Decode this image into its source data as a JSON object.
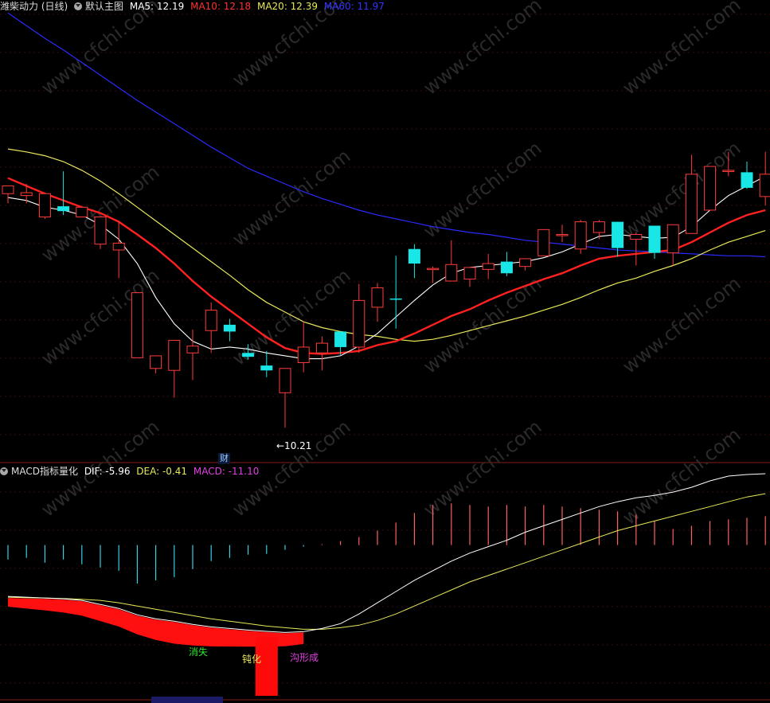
{
  "main_header": {
    "stock_name": "潍柴动力 (日线)",
    "chart_name": "默认主图",
    "ma5": "MA5: 12.19",
    "ma10": "MA10: 12.18",
    "ma20": "MA20: 12.39",
    "ma60": "MA60: 11.97"
  },
  "macd_header": {
    "name": "MACD指标量化",
    "dif": "DIF: -5.96",
    "dea": "DEA: -0.41",
    "macd": "MACD: -11.10"
  },
  "annotations": {
    "low_price": "←10.21",
    "cai_badge": "财",
    "xiaoshi": "消失",
    "dunhua": "钝化",
    "gouxingcheng": "沟形成"
  },
  "colors": {
    "ma5": "#ffffff",
    "ma10": "#ff2020",
    "ma20": "#e8e85a",
    "ma60": "#2a2aff",
    "up": "#ff3b3b",
    "down": "#19e6e6",
    "macd_pos": "#ff6060",
    "macd_neg": "#35d0e8",
    "dif": "#ffffff",
    "dea": "#e8e85a",
    "watermark": "#2a2a2a"
  },
  "chart_data": {
    "type": "candlestick",
    "y_range": [
      9.9,
      14.45
    ],
    "candles": [
      [
        12.62,
        12.7,
        12.52,
        12.7
      ],
      [
        12.6,
        12.63,
        12.72,
        12.52
      ],
      [
        12.38,
        12.62,
        12.62,
        12.36
      ],
      [
        12.49,
        12.44,
        12.85,
        12.4
      ],
      [
        12.38,
        12.48,
        12.48,
        12.38
      ],
      [
        12.1,
        12.38,
        12.38,
        12.05
      ],
      [
        12.04,
        12.11,
        12.34,
        11.75
      ],
      [
        10.93,
        11.6,
        11.6,
        10.93
      ],
      [
        10.82,
        10.95,
        10.95,
        10.77
      ],
      [
        10.8,
        11.11,
        11.11,
        10.52
      ],
      [
        10.98,
        11.05,
        11.22,
        10.7
      ],
      [
        11.21,
        11.42,
        11.5,
        10.98
      ],
      [
        11.27,
        11.2,
        11.33,
        11.1
      ],
      [
        10.98,
        10.94,
        11.07,
        10.91
      ],
      [
        10.85,
        10.8,
        11.0,
        10.73
      ],
      [
        10.57,
        10.82,
        10.82,
        10.21
      ],
      [
        10.88,
        11.04,
        11.3,
        10.78
      ],
      [
        10.98,
        11.08,
        11.15,
        10.8
      ],
      [
        11.2,
        11.04,
        11.2,
        10.96
      ],
      [
        11.04,
        11.52,
        11.69,
        10.98
      ],
      [
        11.45,
        11.65,
        11.7,
        11.3
      ],
      [
        11.54,
        11.53,
        11.98,
        11.23
      ],
      [
        12.05,
        11.9,
        12.1,
        11.75
      ],
      [
        11.85,
        11.85,
        11.87,
        11.7
      ],
      [
        11.72,
        11.89,
        12.14,
        11.72
      ],
      [
        11.74,
        11.86,
        11.86,
        11.66
      ],
      [
        11.84,
        11.9,
        12.0,
        11.74
      ],
      [
        11.92,
        11.8,
        12.02,
        11.77
      ],
      [
        11.87,
        11.95,
        11.95,
        11.83
      ],
      [
        11.98,
        12.25,
        12.25,
        11.98
      ],
      [
        12.2,
        12.2,
        12.3,
        12.12
      ],
      [
        12.05,
        12.33,
        12.35,
        12.0
      ],
      [
        12.22,
        12.33,
        12.35,
        12.15
      ],
      [
        12.33,
        12.06,
        12.33,
        11.97
      ],
      [
        12.15,
        12.2,
        12.22,
        11.88
      ],
      [
        12.29,
        12.01,
        12.29,
        11.95
      ],
      [
        12.01,
        12.3,
        12.3,
        11.88
      ],
      [
        12.21,
        12.82,
        13.02,
        12.21
      ],
      [
        12.45,
        12.9,
        12.9,
        12.45
      ],
      [
        12.86,
        12.86,
        13.05,
        12.8
      ],
      [
        12.84,
        12.68,
        12.95,
        12.67
      ],
      [
        12.59,
        12.82,
        13.05,
        12.5
      ]
    ],
    "ma5": [
      12.58,
      12.55,
      12.48,
      12.45,
      12.4,
      12.3,
      12.15,
      11.9,
      11.55,
      11.28,
      11.1,
      11.02,
      11.04,
      11.02,
      10.98,
      10.95,
      10.92,
      10.92,
      10.95,
      11.05,
      11.18,
      11.35,
      11.52,
      11.68,
      11.8,
      11.86,
      11.88,
      11.9,
      11.92,
      11.96,
      12.02,
      12.1,
      12.18,
      12.2,
      12.18,
      12.16,
      12.17,
      12.28,
      12.45,
      12.6,
      12.7,
      12.8
    ],
    "ma10": [
      12.78,
      12.7,
      12.62,
      12.55,
      12.48,
      12.42,
      12.33,
      12.2,
      12.06,
      11.9,
      11.72,
      11.56,
      11.42,
      11.28,
      11.14,
      11.03,
      10.98,
      10.97,
      10.98,
      11.0,
      11.06,
      11.1,
      11.18,
      11.27,
      11.36,
      11.43,
      11.52,
      11.6,
      11.67,
      11.74,
      11.8,
      11.88,
      11.95,
      11.98,
      12.0,
      12.02,
      12.04,
      12.12,
      12.22,
      12.32,
      12.4,
      12.45
    ],
    "ma20": [
      13.08,
      13.05,
      13.01,
      12.95,
      12.86,
      12.75,
      12.62,
      12.48,
      12.34,
      12.2,
      12.06,
      11.92,
      11.78,
      11.63,
      11.5,
      11.4,
      11.3,
      11.24,
      11.2,
      11.17,
      11.15,
      11.12,
      11.1,
      11.12,
      11.16,
      11.21,
      11.26,
      11.31,
      11.36,
      11.42,
      11.48,
      11.55,
      11.63,
      11.7,
      11.75,
      11.82,
      11.88,
      11.95,
      12.04,
      12.12,
      12.18,
      12.24
    ],
    "ma60": [
      14.48,
      14.35,
      14.22,
      14.1,
      13.97,
      13.84,
      13.71,
      13.58,
      13.46,
      13.34,
      13.22,
      13.1,
      12.99,
      12.88,
      12.8,
      12.72,
      12.64,
      12.57,
      12.51,
      12.45,
      12.4,
      12.36,
      12.32,
      12.28,
      12.25,
      12.22,
      12.2,
      12.17,
      12.14,
      12.12,
      12.1,
      12.08,
      12.06,
      12.04,
      12.03,
      12.02,
      12.01,
      12.0,
      11.99,
      11.98,
      11.98,
      11.97
    ],
    "macd_bars": [
      -0.9,
      -0.8,
      -1.1,
      -0.9,
      -1.2,
      -1.4,
      -1.6,
      -2.4,
      -2.2,
      -2.0,
      -1.5,
      -1.0,
      -0.8,
      -0.6,
      -0.55,
      -0.3,
      -0.1,
      0.05,
      0.25,
      0.5,
      0.9,
      1.4,
      2.0,
      2.5,
      2.6,
      2.5,
      2.4,
      2.5,
      2.4,
      2.5,
      2.4,
      2.3,
      2.2,
      2.1,
      1.9,
      1.5,
      1.0,
      1.2,
      1.5,
      1.6,
      1.7,
      1.8
    ],
    "dif": [
      -3.2,
      -3.25,
      -3.3,
      -3.35,
      -3.45,
      -3.7,
      -3.95,
      -4.35,
      -4.6,
      -4.75,
      -4.95,
      -5.1,
      -5.2,
      -5.3,
      -5.38,
      -5.45,
      -5.4,
      -5.2,
      -4.9,
      -4.3,
      -3.6,
      -2.9,
      -2.2,
      -1.6,
      -1.0,
      -0.5,
      -0.1,
      0.3,
      0.8,
      1.2,
      1.6,
      2.0,
      2.4,
      2.7,
      2.95,
      3.1,
      3.3,
      3.6,
      4.0,
      4.3,
      4.4,
      4.45
    ],
    "dea": [
      -3.25,
      -3.28,
      -3.3,
      -3.33,
      -3.38,
      -3.45,
      -3.6,
      -3.8,
      -4.0,
      -4.2,
      -4.4,
      -4.6,
      -4.75,
      -4.9,
      -5.05,
      -5.15,
      -5.25,
      -5.25,
      -5.15,
      -5.0,
      -4.7,
      -4.3,
      -3.8,
      -3.3,
      -2.8,
      -2.3,
      -1.9,
      -1.5,
      -1.1,
      -0.7,
      -0.3,
      0.1,
      0.5,
      0.9,
      1.2,
      1.5,
      1.8,
      2.1,
      2.4,
      2.7,
      3.0,
      3.2
    ],
    "macd_y_range": [
      -9.5,
      4.2
    ],
    "big_red_bar": {
      "index": 14,
      "top": -5.75,
      "bottom": -9.4
    }
  }
}
